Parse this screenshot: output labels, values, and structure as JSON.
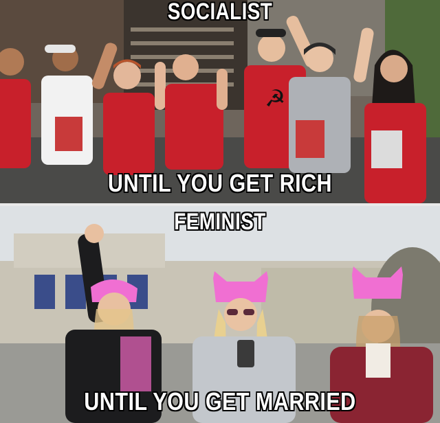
{
  "meme": {
    "top_panel": {
      "title": "SOCIALIST",
      "subtitle": "UNTIL YOU GET RICH"
    },
    "bottom_panel": {
      "title": "FEMINIST",
      "subtitle": "UNTIL YOU GET MARRIED"
    }
  },
  "colors": {
    "shirt_red": "#c8202b",
    "hat_pink": "#f06fd2",
    "caption_text": "#ffffff",
    "caption_outline": "#000000"
  }
}
